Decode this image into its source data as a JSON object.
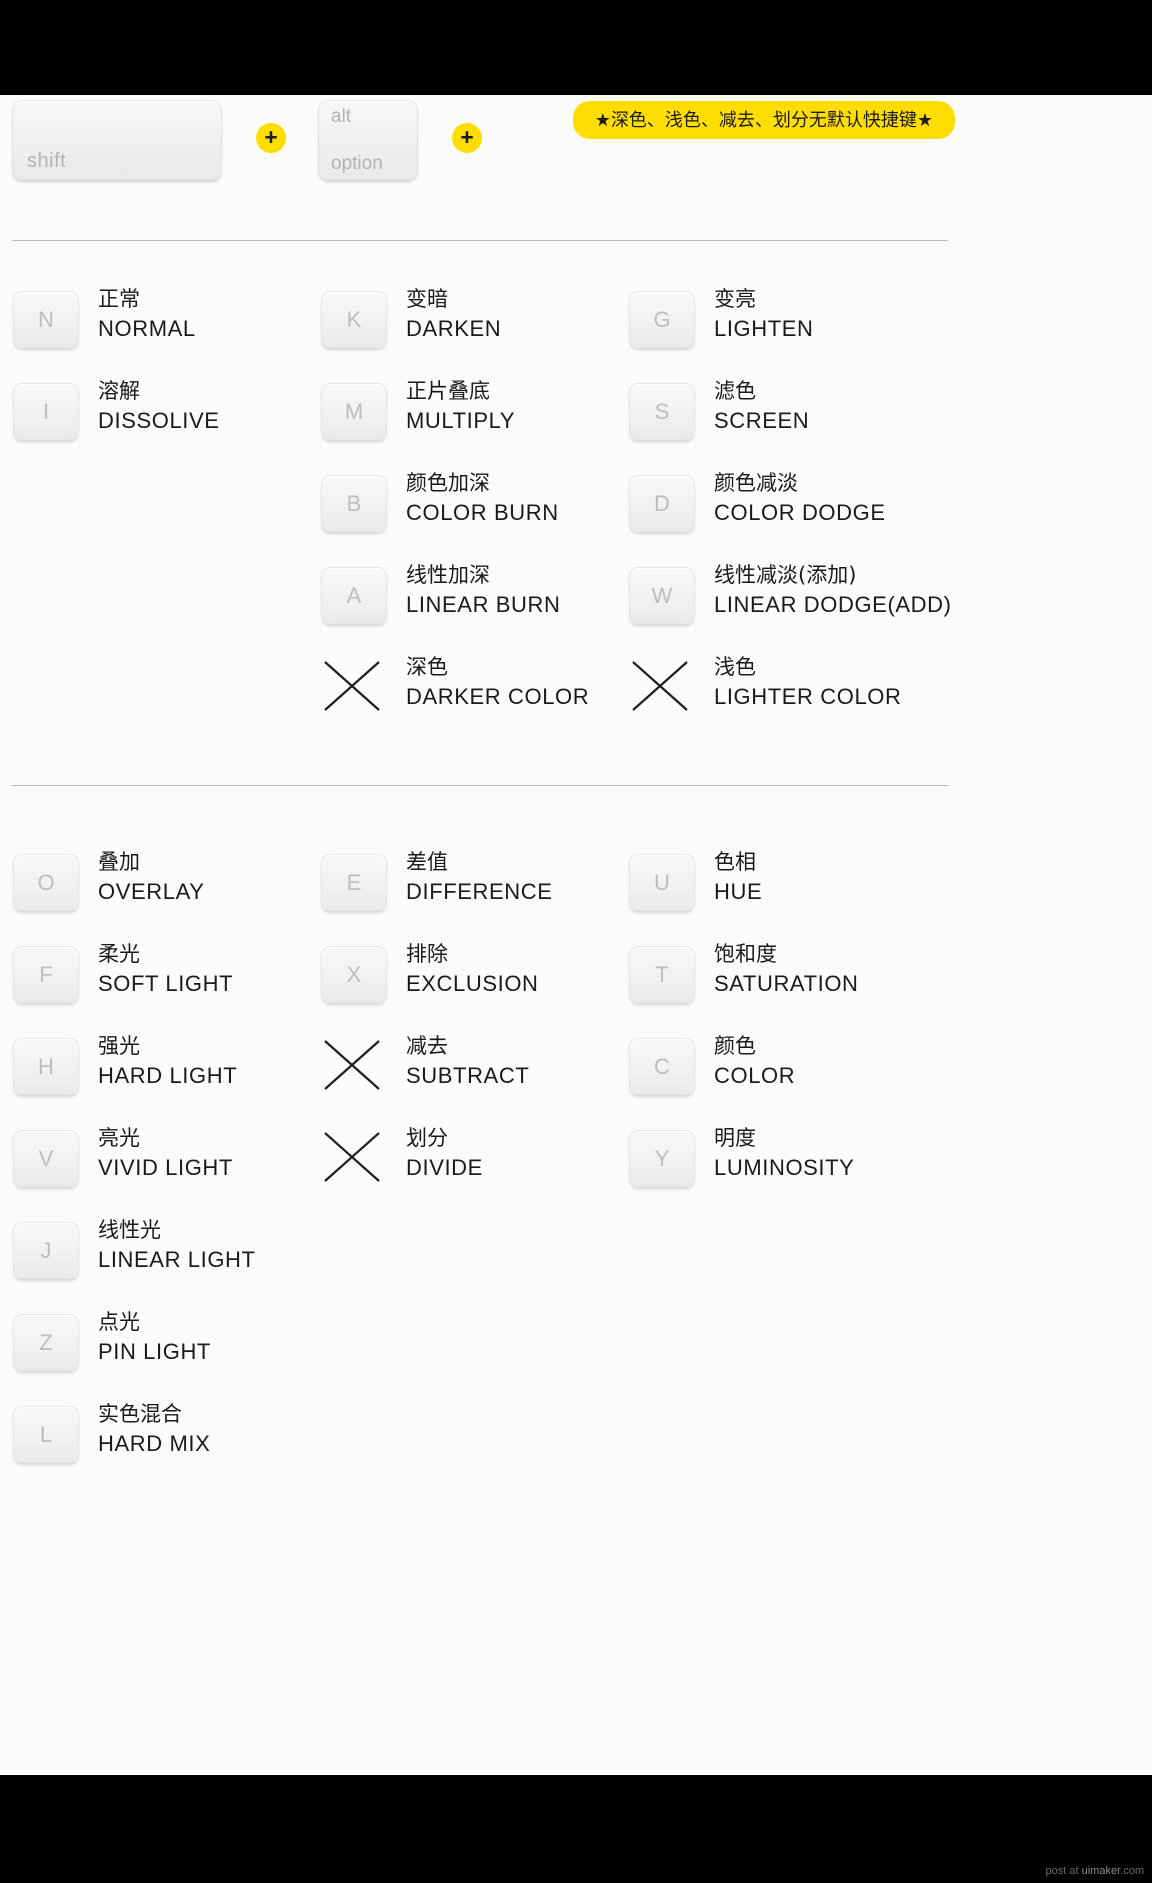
{
  "header": {
    "modifier_keys": [
      {
        "name": "shift-key",
        "label": "shift"
      },
      {
        "name": "alt-option-key",
        "label_top": "alt",
        "label_bottom": "option"
      }
    ],
    "plus_symbol": "+",
    "banner_note": "★深色、浅色、减去、划分无默认快捷键★"
  },
  "colors": {
    "accent_yellow": "#ffdd00",
    "keycap_face": "#f1f1f1",
    "keycap_letter": "#bdbdbd",
    "text": "#1a1a1a",
    "sheet_bg": "#fbfcfa",
    "page_bg": "#000000",
    "divider": "#b9b9b9"
  },
  "sections": [
    {
      "id": "section-normal-darken-lighten",
      "columns": [
        {
          "id": "column-normal",
          "items": [
            {
              "key": "N",
              "has_key": true,
              "cn": "正常",
              "en": "NORMAL"
            },
            {
              "key": "I",
              "has_key": true,
              "cn": "溶解",
              "en": "DISSOLIVE"
            }
          ]
        },
        {
          "id": "column-darken",
          "items": [
            {
              "key": "K",
              "has_key": true,
              "cn": "变暗",
              "en": "DARKEN"
            },
            {
              "key": "M",
              "has_key": true,
              "cn": "正片叠底",
              "en": "MULTIPLY"
            },
            {
              "key": "B",
              "has_key": true,
              "cn": "颜色加深",
              "en": "COLOR BURN"
            },
            {
              "key": "A",
              "has_key": true,
              "cn": "线性加深",
              "en": "LINEAR BURN"
            },
            {
              "key": "",
              "has_key": false,
              "cn": "深色",
              "en": "DARKER COLOR"
            }
          ]
        },
        {
          "id": "column-lighten",
          "items": [
            {
              "key": "G",
              "has_key": true,
              "cn": "变亮",
              "en": "LIGHTEN"
            },
            {
              "key": "S",
              "has_key": true,
              "cn": "滤色",
              "en": "SCREEN"
            },
            {
              "key": "D",
              "has_key": true,
              "cn": "颜色减淡",
              "en": "COLOR DODGE"
            },
            {
              "key": "W",
              "has_key": true,
              "cn": "线性减淡(添加)",
              "en": "LINEAR DODGE(ADD)"
            },
            {
              "key": "",
              "has_key": false,
              "cn": "浅色",
              "en": "LIGHTER COLOR"
            }
          ]
        }
      ]
    },
    {
      "id": "section-contrast-comparative-component",
      "columns": [
        {
          "id": "column-contrast",
          "items": [
            {
              "key": "O",
              "has_key": true,
              "cn": "叠加",
              "en": "OVERLAY"
            },
            {
              "key": "F",
              "has_key": true,
              "cn": "柔光",
              "en": "SOFT LIGHT"
            },
            {
              "key": "H",
              "has_key": true,
              "cn": "强光",
              "en": "HARD LIGHT"
            },
            {
              "key": "V",
              "has_key": true,
              "cn": "亮光",
              "en": "VIVID LIGHT"
            },
            {
              "key": "J",
              "has_key": true,
              "cn": "线性光",
              "en": "LINEAR LIGHT"
            },
            {
              "key": "Z",
              "has_key": true,
              "cn": "点光",
              "en": "PIN LIGHT"
            },
            {
              "key": "L",
              "has_key": true,
              "cn": "实色混合",
              "en": "HARD MIX"
            }
          ]
        },
        {
          "id": "column-comparative",
          "items": [
            {
              "key": "E",
              "has_key": true,
              "cn": "差值",
              "en": "DIFFERENCE"
            },
            {
              "key": "X",
              "has_key": true,
              "cn": "排除",
              "en": "EXCLUSION"
            },
            {
              "key": "",
              "has_key": false,
              "cn": "减去",
              "en": "SUBTRACT"
            },
            {
              "key": "",
              "has_key": false,
              "cn": "划分",
              "en": "DIVIDE"
            }
          ]
        },
        {
          "id": "column-component",
          "items": [
            {
              "key": "U",
              "has_key": true,
              "cn": "色相",
              "en": "HUE"
            },
            {
              "key": "T",
              "has_key": true,
              "cn": "饱和度",
              "en": "SATURATION"
            },
            {
              "key": "C",
              "has_key": true,
              "cn": "颜色",
              "en": "COLOR"
            },
            {
              "key": "Y",
              "has_key": true,
              "cn": "明度",
              "en": "LUMINOSITY"
            }
          ]
        }
      ]
    }
  ],
  "watermark": {
    "prefix": "post at ",
    "site": "uimaker",
    "suffix": ".com"
  }
}
